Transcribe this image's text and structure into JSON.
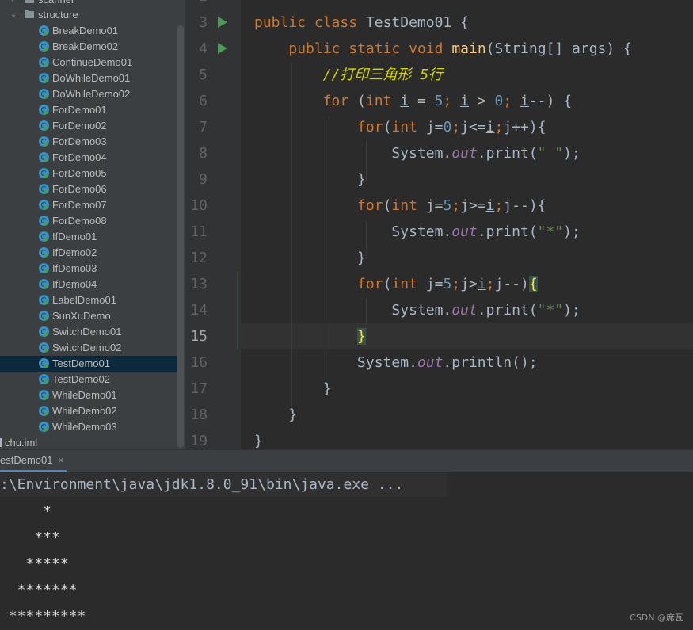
{
  "project_tree": {
    "top_items": [
      {
        "label": "scanner",
        "kind": "folder",
        "expanded": false
      },
      {
        "label": "structure",
        "kind": "folder",
        "expanded": true
      }
    ],
    "classes": [
      "BreakDemo01",
      "BreakDemo02",
      "ContinueDemo01",
      "DoWhileDemo01",
      "DoWhileDemo02",
      "ForDemo01",
      "ForDemo02",
      "ForDemo03",
      "ForDemo04",
      "ForDemo05",
      "ForDemo06",
      "ForDemo07",
      "ForDemo08",
      "IfDemo01",
      "IfDemo02",
      "IfDemo03",
      "IfDemo04",
      "LabelDemo01",
      "SunXuDemo",
      "SwitchDemo01",
      "SwitchDemo02",
      "TestDemo01",
      "TestDemo02",
      "WhileDemo01",
      "WhileDemo02",
      "WhileDemo03"
    ],
    "selected_class": "TestDemo01",
    "iml_file": "chu.iml"
  },
  "editor": {
    "line_numbers": [
      "2",
      "3",
      "4",
      "5",
      "6",
      "7",
      "8",
      "9",
      "10",
      "11",
      "12",
      "13",
      "14",
      "15",
      "16",
      "17",
      "18",
      "19"
    ],
    "current_line": "15",
    "code": {
      "l3": {
        "kw1": "public",
        "kw2": "class",
        "cls": " TestDemo01 {"
      },
      "l4": {
        "kw1": "public",
        "kw2": "static",
        "kw3": "void",
        "fn": "main",
        "rest": "(String[] args) {"
      },
      "l5": {
        "comment": "//打印三角形 5行"
      },
      "l6": {
        "kw": "for",
        "p1": " (",
        "kw2": "int",
        "sp": " ",
        "v1": "i",
        "eq": " = ",
        "n1": "5",
        "s1": "; ",
        "v2": "i",
        "gt": " > ",
        "n2": "0",
        "s2": "; ",
        "v3": "i",
        "end": "--) {"
      },
      "l7": {
        "kw": "for",
        "p1": "(",
        "kw2": "int",
        "a": " j=",
        "n": "0",
        "s1": ";",
        "b": "j<=",
        "v": "i",
        "s2": ";",
        "c": "j++){"
      },
      "l8": {
        "a": "System.",
        "out": "out",
        "b": ".print(",
        "str": "\" \"",
        "c": ");"
      },
      "l9": {
        "t": "}"
      },
      "l10": {
        "kw": "for",
        "p1": "(",
        "kw2": "int",
        "a": " j=",
        "n": "5",
        "s1": ";",
        "b": "j>=",
        "v": "i",
        "s2": ";",
        "c": "j--){"
      },
      "l11": {
        "a": "System.",
        "out": "out",
        "b": ".print(",
        "str": "\"*\"",
        "c": ");"
      },
      "l12": {
        "t": "}"
      },
      "l13": {
        "kw": "for",
        "p1": "(",
        "kw2": "int",
        "a": " j=",
        "n": "5",
        "s1": ";",
        "b": "j>",
        "v": "i",
        "s2": ";",
        "c": "j--)",
        "br": "{"
      },
      "l14": {
        "a": "System.",
        "out": "out",
        "b": ".print(",
        "str": "\"*\"",
        "c": ");"
      },
      "l15": {
        "br": "}"
      },
      "l16": {
        "a": "System.",
        "out": "out",
        "b": ".println();"
      },
      "l17": {
        "t": "}"
      },
      "l18": {
        "t": "}"
      },
      "l19": {
        "t": "}"
      }
    }
  },
  "run_panel": {
    "tab_label": "estDemo01",
    "close_label": "×",
    "command": ":\\Environment\\java\\jdk1.8.0_91\\bin\\java.exe ...",
    "output_lines": [
      "     *",
      "    ***",
      "   *****",
      "  *******",
      " *********"
    ]
  },
  "watermark": "CSDN @席瓦"
}
